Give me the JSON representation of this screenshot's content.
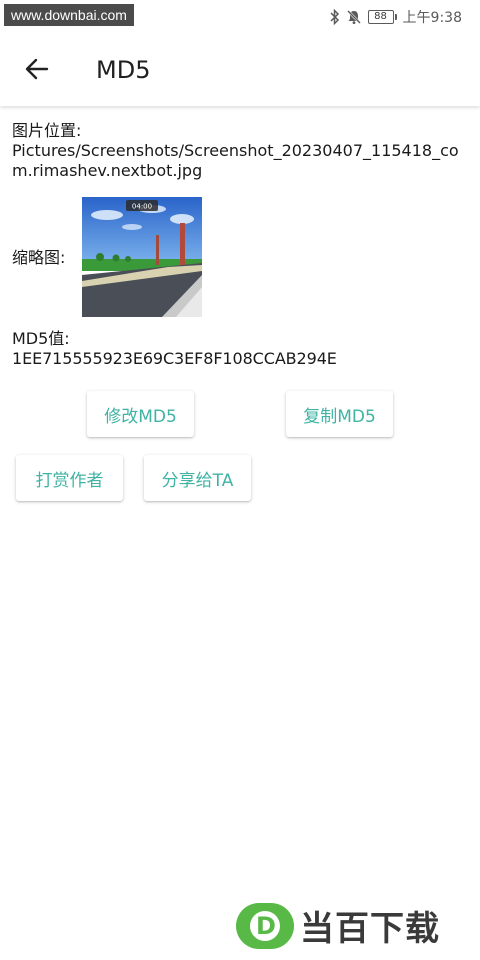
{
  "status_bar": {
    "watermark": "www.downbai.com",
    "battery": "88",
    "time": "上午9:38",
    "icons": [
      "bluetooth-icon",
      "mute-icon",
      "battery-icon"
    ]
  },
  "app_bar": {
    "back_icon": "arrow-left-icon",
    "title": "MD5"
  },
  "content": {
    "path_label": "图片位置:",
    "path_line1": "Pictures/Screenshots/Screenshot_20230407_115418_co",
    "path_line2": "m.rimashev.nextbot.jpg",
    "thumbnail_label": "缩略图:",
    "thumbnail_timer": "04:00",
    "md5_label": "MD5值:",
    "md5_value": "1EE715555923E69C3EF8F108CCAB294E"
  },
  "buttons": {
    "modify": "修改MD5",
    "copy": "复制MD5",
    "reward": "打赏作者",
    "share": "分享给TA"
  },
  "watermark_logo": {
    "letter": "D",
    "text": "当百下载"
  },
  "colors": {
    "accent": "#3fb3a4",
    "logo_green": "#58b947"
  }
}
